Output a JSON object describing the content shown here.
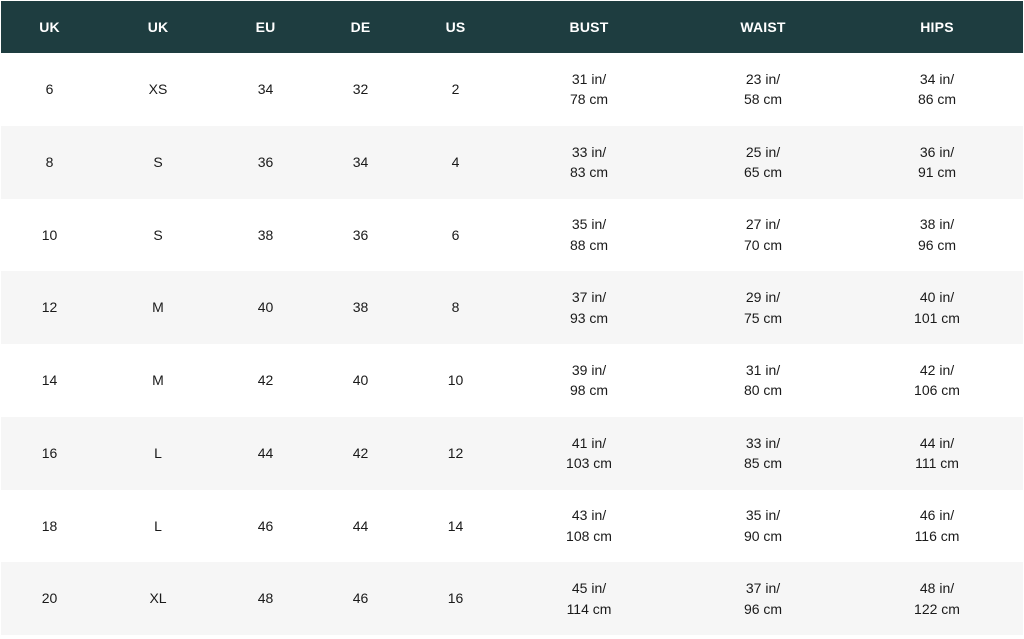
{
  "table": {
    "headers": [
      "UK",
      "UK",
      "EU",
      "DE",
      "US",
      "BUST",
      "WAIST",
      "HIPS"
    ],
    "header_bg": "#1e3d40",
    "row_alt_bg": "#f6f6f6",
    "rows": [
      {
        "uk": "6",
        "uk_letter": "XS",
        "eu": "34",
        "de": "32",
        "us": "2",
        "bust_in": "31 in/",
        "bust_cm": "78 cm",
        "waist_in": "23 in/",
        "waist_cm": "58 cm",
        "hips_in": "34 in/",
        "hips_cm": "86 cm"
      },
      {
        "uk": "8",
        "uk_letter": "S",
        "eu": "36",
        "de": "34",
        "us": "4",
        "bust_in": "33 in/",
        "bust_cm": "83 cm",
        "waist_in": "25 in/",
        "waist_cm": "65 cm",
        "hips_in": "36 in/",
        "hips_cm": "91 cm"
      },
      {
        "uk": "10",
        "uk_letter": "S",
        "eu": "38",
        "de": "36",
        "us": "6",
        "bust_in": "35 in/",
        "bust_cm": "88 cm",
        "waist_in": "27 in/",
        "waist_cm": "70 cm",
        "hips_in": "38 in/",
        "hips_cm": "96 cm"
      },
      {
        "uk": "12",
        "uk_letter": "M",
        "eu": "40",
        "de": "38",
        "us": "8",
        "bust_in": "37 in/",
        "bust_cm": "93 cm",
        "waist_in": "29 in/",
        "waist_cm": "75 cm",
        "hips_in": "40 in/",
        "hips_cm": "101 cm"
      },
      {
        "uk": "14",
        "uk_letter": "M",
        "eu": "42",
        "de": "40",
        "us": "10",
        "bust_in": "39 in/",
        "bust_cm": "98 cm",
        "waist_in": "31 in/",
        "waist_cm": "80 cm",
        "hips_in": "42 in/",
        "hips_cm": "106 cm"
      },
      {
        "uk": "16",
        "uk_letter": "L",
        "eu": "44",
        "de": "42",
        "us": "12",
        "bust_in": "41 in/",
        "bust_cm": "103 cm",
        "waist_in": "33 in/",
        "waist_cm": "85 cm",
        "hips_in": "44 in/",
        "hips_cm": "111 cm"
      },
      {
        "uk": "18",
        "uk_letter": "L",
        "eu": "46",
        "de": "44",
        "us": "14",
        "bust_in": "43 in/",
        "bust_cm": "108 cm",
        "waist_in": "35 in/",
        "waist_cm": "90 cm",
        "hips_in": "46 in/",
        "hips_cm": "116 cm"
      },
      {
        "uk": "20",
        "uk_letter": "XL",
        "eu": "48",
        "de": "46",
        "us": "16",
        "bust_in": "45 in/",
        "bust_cm": "114 cm",
        "waist_in": "37 in/",
        "waist_cm": "96 cm",
        "hips_in": "48 in/",
        "hips_cm": "122 cm"
      }
    ]
  }
}
